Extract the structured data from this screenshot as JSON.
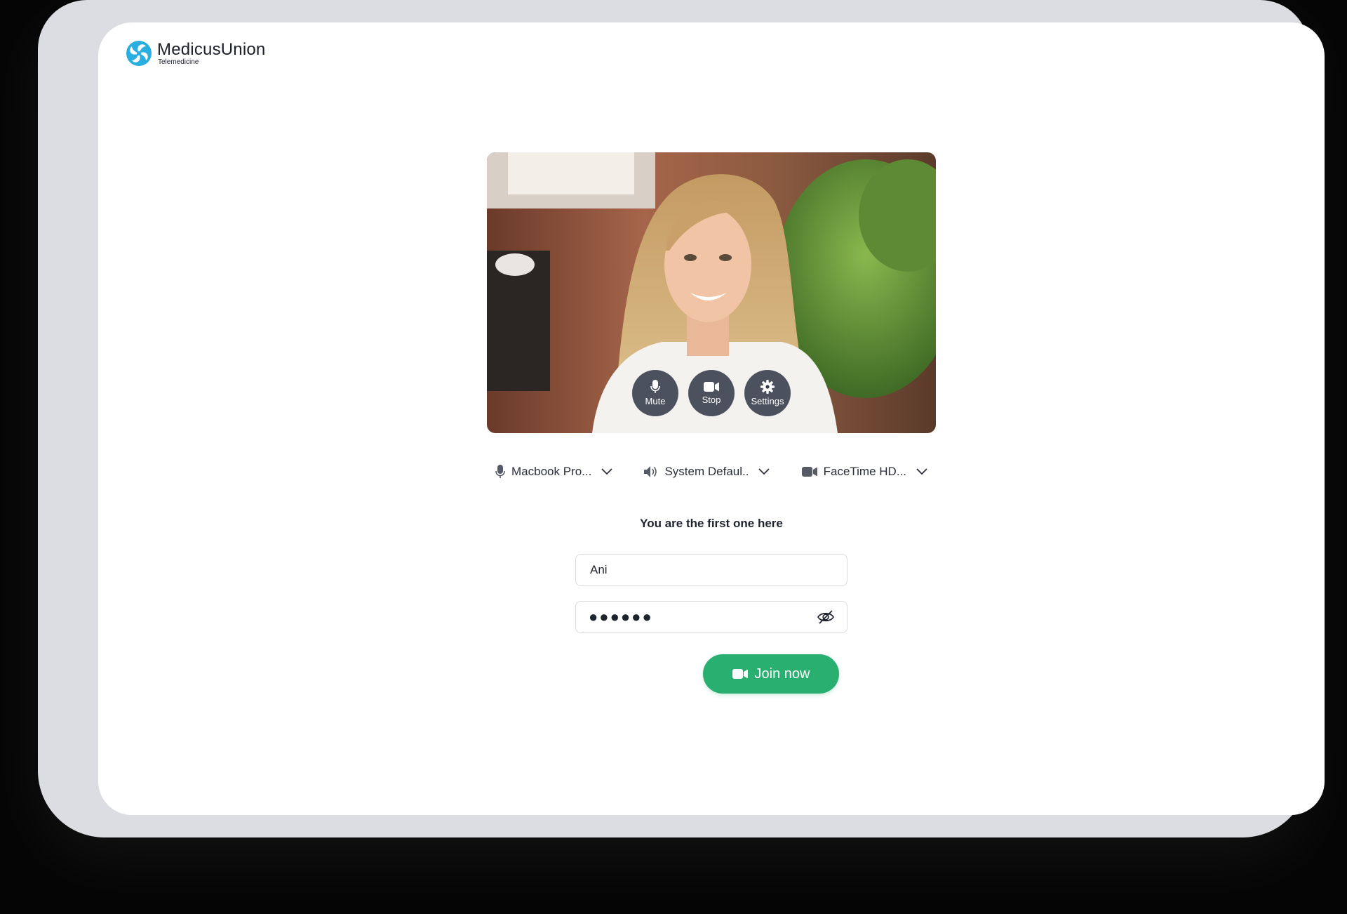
{
  "brand": {
    "name": "MedicusUnion",
    "subtitle": "Telemedicine",
    "color": "#29aee0"
  },
  "video_controls": [
    {
      "label": "Mute",
      "icon": "microphone-icon"
    },
    {
      "label": "Stop",
      "icon": "video-camera-icon"
    },
    {
      "label": "Settings",
      "icon": "gear-icon"
    }
  ],
  "devices": {
    "microphone": {
      "label": "Macbook Pro...",
      "icon": "microphone-icon"
    },
    "speaker": {
      "label": "System Defaul..",
      "icon": "speaker-icon"
    },
    "camera": {
      "label": "FaceTime HD...",
      "icon": "video-camera-icon"
    }
  },
  "notice": "You are the first one here",
  "form": {
    "name_value": "Ani",
    "password_mask": "●●●●●●"
  },
  "join_label": "Join now",
  "colors": {
    "accent": "#29b070",
    "control_bg": "#343a4a"
  }
}
